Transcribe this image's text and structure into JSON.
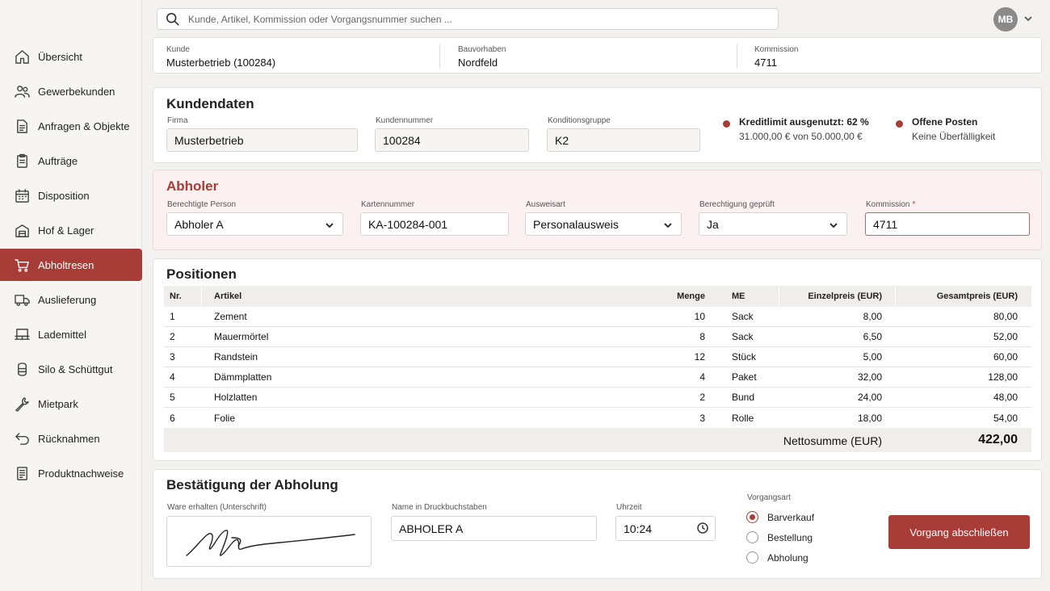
{
  "search": {
    "placeholder": "Kunde, Artikel, Kommission oder Vorgangsnummer suchen ..."
  },
  "user": {
    "initials": "MB"
  },
  "sidebar": {
    "items": [
      {
        "label": "Übersicht",
        "icon": "home-icon"
      },
      {
        "label": "Gewerbekunden",
        "icon": "users-icon"
      },
      {
        "label": "Anfragen & Objekte",
        "icon": "document-icon"
      },
      {
        "label": "Aufträge",
        "icon": "clipboard-icon"
      },
      {
        "label": "Disposition",
        "icon": "calendar-icon"
      },
      {
        "label": "Hof & Lager",
        "icon": "warehouse-icon"
      },
      {
        "label": "Abholtresen",
        "icon": "cart-icon",
        "active": true
      },
      {
        "label": "Auslieferung",
        "icon": "truck-icon"
      },
      {
        "label": "Lademittel",
        "icon": "pallet-icon"
      },
      {
        "label": "Silo & Schüttgut",
        "icon": "silo-icon"
      },
      {
        "label": "Mietpark",
        "icon": "wrench-icon"
      },
      {
        "label": "Rücknahmen",
        "icon": "return-icon"
      },
      {
        "label": "Produktnachweise",
        "icon": "certificate-icon"
      }
    ]
  },
  "info": {
    "kunde_label": "Kunde",
    "kunde_value": "Musterbetrieb (100284)",
    "bauvorhaben_label": "Bauvorhaben",
    "bauvorhaben_value": "Nordfeld",
    "kommission_label": "Kommission",
    "kommission_value": "4711"
  },
  "kundendaten": {
    "title": "Kundendaten",
    "firma_label": "Firma",
    "firma_value": "Musterbetrieb",
    "kundennummer_label": "Kundennummer",
    "kundennummer_value": "100284",
    "konditionsgruppe_label": "Konditionsgruppe",
    "konditionsgruppe_value": "K2",
    "kreditlimit_title": "Kreditlimit ausgenutzt: 62 %",
    "kreditlimit_detail": "31.000,00 € von 50.000,00 €",
    "offene_title": "Offene Posten",
    "offene_detail": "Keine Überfälligkeit",
    "status_color": "#a83c37"
  },
  "abholer": {
    "title": "Abholer",
    "person_label": "Berechtigte Person",
    "person_value": "Abholer A",
    "karte_label": "Kartennummer",
    "karte_value": "KA-100284-001",
    "ausweis_label": "Ausweisart",
    "ausweis_value": "Personalausweis",
    "geprueft_label": "Berechtigung geprüft",
    "geprueft_value": "Ja",
    "kommission_label": "Kommission",
    "kommission_required": "*",
    "kommission_value": "4711"
  },
  "positionen": {
    "title": "Positionen",
    "headers": {
      "nr": "Nr.",
      "artikel": "Artikel",
      "menge": "Menge",
      "me": "ME",
      "einzelpreis": "Einzelpreis (EUR)",
      "gesamtpreis": "Gesamtpreis (EUR)"
    },
    "rows": [
      {
        "nr": "1",
        "artikel": "Zement",
        "menge": "10",
        "me": "Sack",
        "einzelpreis": "8,00",
        "gesamtpreis": "80,00"
      },
      {
        "nr": "2",
        "artikel": "Mauermörtel",
        "menge": "8",
        "me": "Sack",
        "einzelpreis": "6,50",
        "gesamtpreis": "52,00"
      },
      {
        "nr": "3",
        "artikel": "Randstein",
        "menge": "12",
        "me": "Stück",
        "einzelpreis": "5,00",
        "gesamtpreis": "60,00"
      },
      {
        "nr": "4",
        "artikel": "Dämmplatten",
        "menge": "4",
        "me": "Paket",
        "einzelpreis": "32,00",
        "gesamtpreis": "128,00"
      },
      {
        "nr": "5",
        "artikel": "Holzlatten",
        "menge": "2",
        "me": "Bund",
        "einzelpreis": "24,00",
        "gesamtpreis": "48,00"
      },
      {
        "nr": "6",
        "artikel": "Folie",
        "menge": "3",
        "me": "Rolle",
        "einzelpreis": "18,00",
        "gesamtpreis": "54,00"
      }
    ],
    "netto_label": "Nettosumme (EUR)",
    "netto_value": "422,00"
  },
  "bestaetigung": {
    "title": "Bestätigung der Abholung",
    "signature_label": "Ware erhalten (Unterschrift)",
    "name_label": "Name in Druckbuchstaben",
    "name_value": "ABHOLER A",
    "uhrzeit_label": "Uhrzeit",
    "uhrzeit_value": "10:24",
    "vorgangsart_label": "Vorgangsart",
    "vorgangsart_options": [
      {
        "label": "Barverkauf",
        "selected": true
      },
      {
        "label": "Bestellung",
        "selected": false
      },
      {
        "label": "Abholung",
        "selected": false
      }
    ],
    "submit_label": "Vorgang abschließen"
  },
  "colors": {
    "accent": "#a83c37",
    "background": "#f3f2f1",
    "pink_card": "#fbf1f0"
  }
}
